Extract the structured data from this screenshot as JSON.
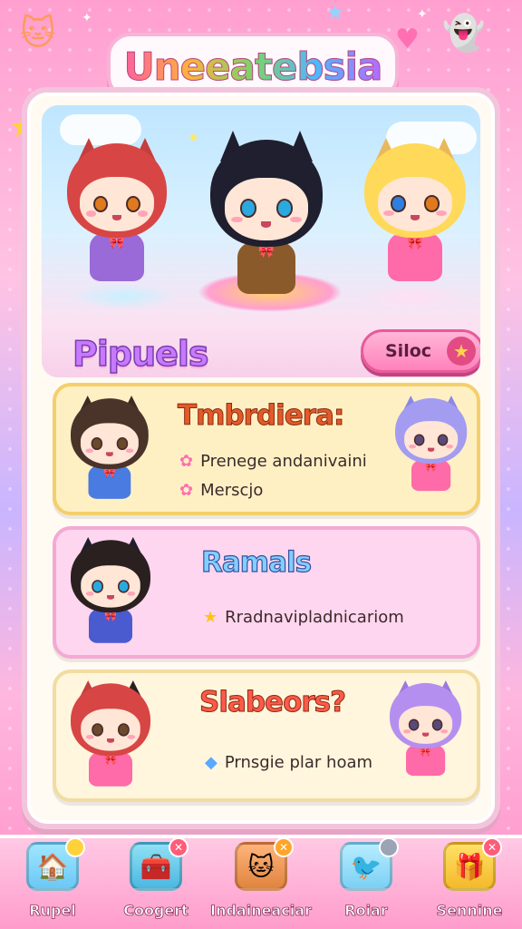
{
  "app": {
    "title": "Uneeatebsia"
  },
  "hero": {
    "label": "Pipuels",
    "select_label": "Siloc",
    "select_icon": "star-icon"
  },
  "cards": [
    {
      "title": "Tmbrdiera:",
      "lines": [
        {
          "icon": "flower-icon",
          "text": "Prenege andanivaini"
        },
        {
          "icon": "flower-icon",
          "text": "Merscjo"
        }
      ]
    },
    {
      "title": "Ramals",
      "lines": [
        {
          "icon": "star-icon",
          "text": "Rradnavipladnicariom"
        }
      ]
    },
    {
      "title": "Slabeors?",
      "lines": [
        {
          "icon": "gem-icon",
          "text": "Prnsgie plar hoam"
        }
      ]
    }
  ],
  "nav": [
    {
      "label": "Rupel",
      "icon": "house-icon"
    },
    {
      "label": "Coogert",
      "icon": "chest-icon"
    },
    {
      "label": "Indaineaciar",
      "icon": "cat-face-icon"
    },
    {
      "label": "Roiar",
      "icon": "bird-icon"
    },
    {
      "label": "Sennine",
      "icon": "gift-box-icon"
    }
  ],
  "colors": {
    "accent": "#ff82bb",
    "card1": "#fff0c4",
    "card2": "#ffd6ef",
    "card3": "#fff6dd"
  }
}
